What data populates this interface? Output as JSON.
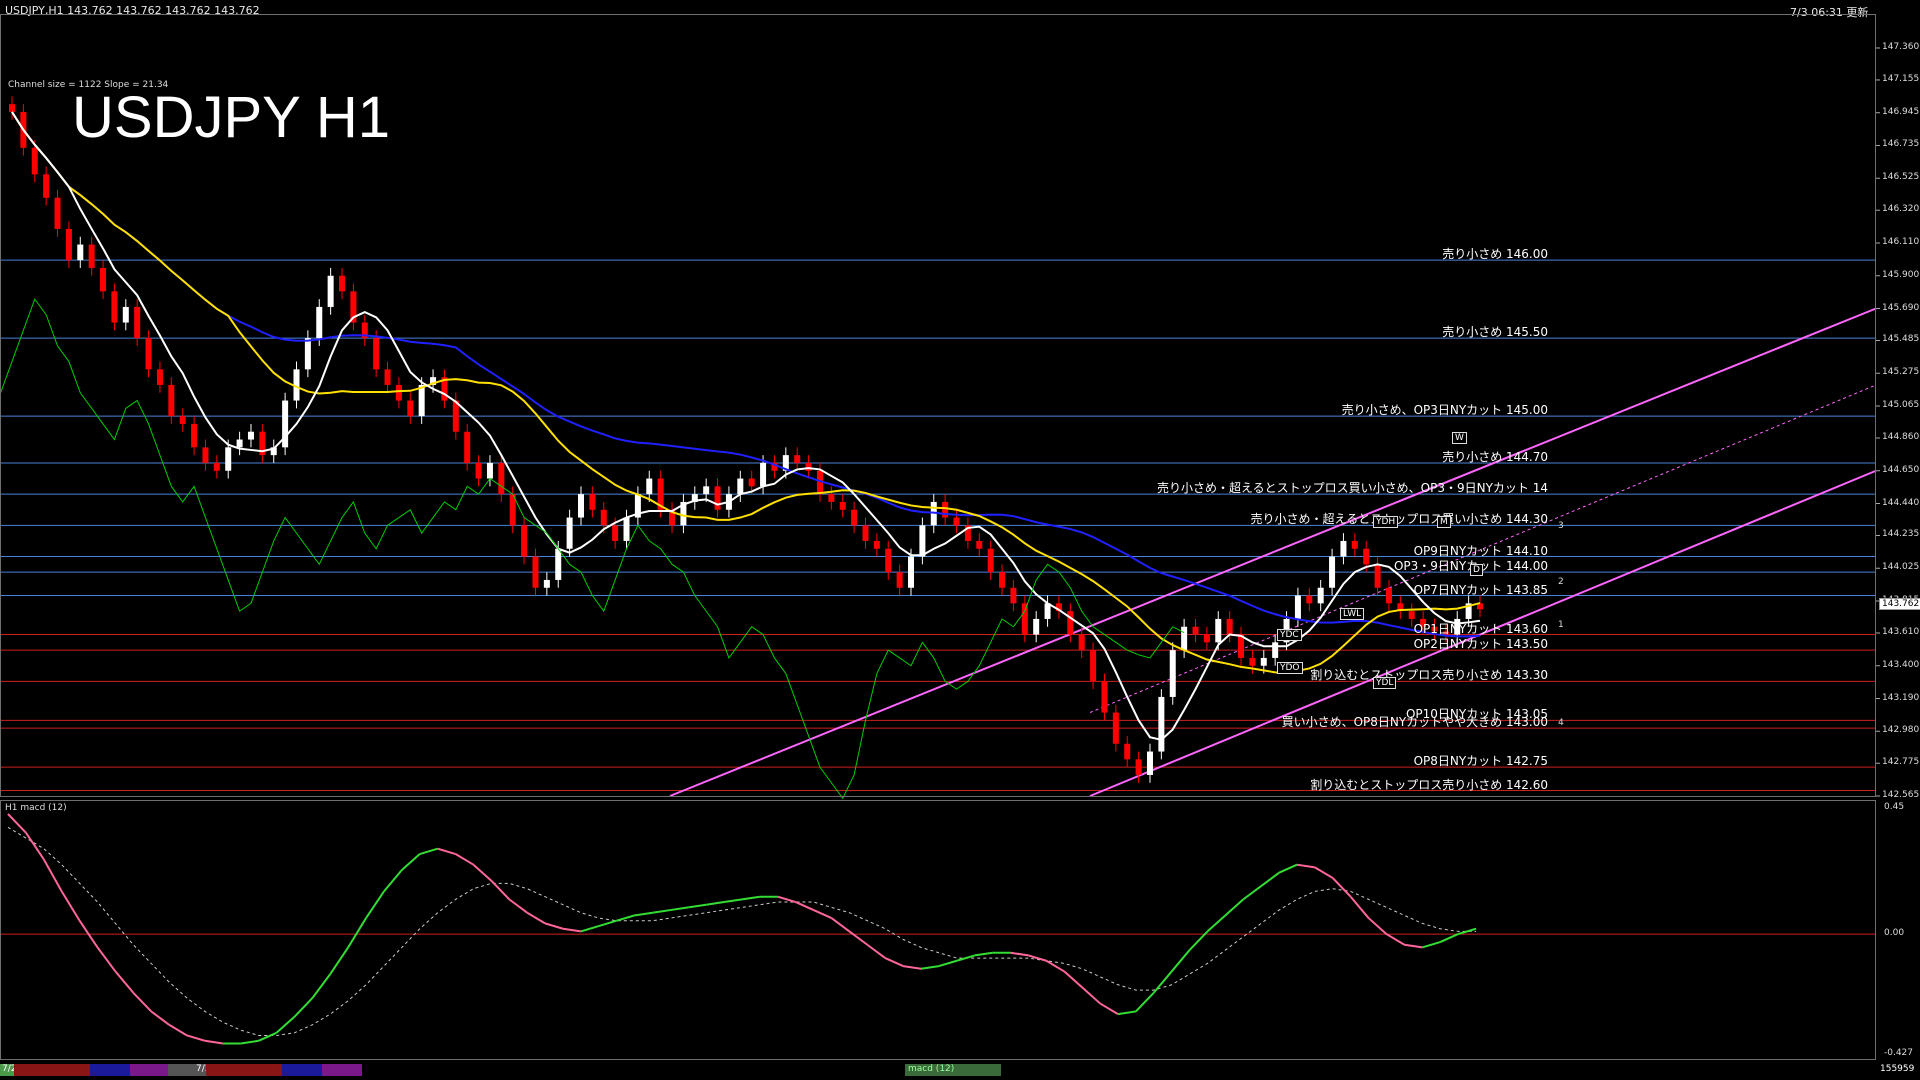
{
  "header": {
    "symbol_info": "USDJPY,H1  143.762 143.762 143.762 143.762",
    "datetime": "7/3 06:31 更新",
    "channel_info": "Channel size = 1122 Slope = 21.34",
    "big_title": "USDJPY H1"
  },
  "current_price": "143.762",
  "macd_label": "H1  macd (12)",
  "macd_ticks": [
    "0.45",
    "0.00",
    "-0.427"
  ],
  "bottom_right_value": "155959",
  "bottom_tab_label": "macd (12)",
  "colors": {
    "background": "#000000",
    "bull_candle": "#ffffff",
    "bear_candle": "#ff0000",
    "ma_short": "#ffffff",
    "ma_mid": "#ffe000",
    "ma_long": "#2020ff",
    "chikou": "#00cc00",
    "channel": "#ff66ff",
    "macd_main": "#ff6699",
    "macd_up": "#33dd33",
    "signal": "#cccccc",
    "level_blue": "#4a82d8",
    "level_red": "#cc2020"
  },
  "chart_data": {
    "type": "candlestick",
    "title": "USDJPY H1",
    "ylim": [
      142.565,
      147.565
    ],
    "y_ticks": [
      "147.360",
      "147.155",
      "146.945",
      "146.735",
      "146.525",
      "146.320",
      "146.110",
      "145.900",
      "145.690",
      "145.485",
      "145.275",
      "145.065",
      "144.860",
      "144.650",
      "144.440",
      "144.235",
      "144.025",
      "143.815",
      "143.610",
      "143.400",
      "143.190",
      "142.980",
      "142.775",
      "142.565"
    ],
    "date_tabs": [
      "7/2",
      "7/3"
    ],
    "close_prices": [
      146.95,
      146.72,
      146.55,
      146.4,
      146.2,
      146.0,
      146.1,
      145.95,
      145.8,
      145.6,
      145.7,
      145.5,
      145.3,
      145.2,
      145.0,
      144.95,
      144.8,
      144.7,
      144.65,
      144.8,
      144.85,
      144.9,
      144.75,
      144.8,
      145.1,
      145.3,
      145.5,
      145.7,
      145.9,
      145.8,
      145.6,
      145.5,
      145.3,
      145.2,
      145.1,
      145.0,
      145.2,
      145.25,
      145.1,
      144.9,
      144.7,
      144.6,
      144.7,
      144.5,
      144.3,
      144.1,
      143.9,
      143.95,
      144.15,
      144.35,
      144.5,
      144.4,
      144.3,
      144.2,
      144.35,
      144.5,
      144.6,
      144.4,
      144.3,
      144.45,
      144.5,
      144.55,
      144.4,
      144.5,
      144.6,
      144.55,
      144.7,
      144.65,
      144.75,
      144.7,
      144.65,
      144.5,
      144.45,
      144.4,
      144.3,
      144.2,
      144.15,
      144.0,
      143.9,
      144.1,
      144.3,
      144.45,
      144.35,
      144.3,
      144.2,
      144.15,
      144.0,
      143.9,
      143.8,
      143.6,
      143.7,
      143.8,
      143.75,
      143.6,
      143.5,
      143.3,
      143.1,
      142.9,
      142.8,
      142.7,
      142.85,
      143.2,
      143.5,
      143.65,
      143.6,
      143.55,
      143.7,
      143.6,
      143.45,
      143.4,
      143.45,
      143.55,
      143.7,
      143.85,
      143.8,
      143.9,
      144.1,
      144.2,
      144.15,
      144.05,
      143.9,
      143.8,
      143.75,
      143.7,
      143.65,
      143.62,
      143.6,
      143.7,
      143.8,
      143.762
    ],
    "price_levels": [
      {
        "price": 146.0,
        "label": "売り小さめ 146.00",
        "color": "#4a82d8"
      },
      {
        "price": 145.5,
        "label": "売り小さめ 145.50",
        "color": "#4a82d8"
      },
      {
        "price": 145.0,
        "label": "売り小さめ、OP3日NYカット 145.00",
        "color": "#4a82d8"
      },
      {
        "price": 144.7,
        "label": "売り小さめ 144.70",
        "color": "#4a82d8"
      },
      {
        "price": 144.5,
        "label": "売り小さめ・超えるとストップロス買い小さめ、OP3・9日NYカット 14",
        "color": "#4a82d8"
      },
      {
        "price": 144.3,
        "label": "売り小さめ・超えるとストップロス買い小さめ 144.30",
        "color": "#4a82d8"
      },
      {
        "price": 144.1,
        "label": "OP9日NYカット 144.10",
        "color": "#4a82d8"
      },
      {
        "price": 144.0,
        "label": "OP3・9日NYカット 144.00",
        "color": "#4a82d8"
      },
      {
        "price": 143.85,
        "label": "OP7日NYカット 143.85",
        "color": "#4a82d8"
      },
      {
        "price": 143.6,
        "label": "OP1日NYカット 143.60",
        "color": "#cc2020"
      },
      {
        "price": 143.5,
        "label": "OP2日NYカット 143.50",
        "color": "#cc2020"
      },
      {
        "price": 143.3,
        "label": "割り込むとストップロス売り小さめ 143.30",
        "color": "#cc2020"
      },
      {
        "price": 143.05,
        "label": "OP10日NYカット 143.05",
        "color": "#cc2020"
      },
      {
        "price": 143.0,
        "label": "買い小さめ、OP8日NYカットやや大きめ 143.00",
        "color": "#cc2020"
      },
      {
        "price": 142.75,
        "label": "OP8日NYカット 142.75",
        "color": "#cc2020"
      },
      {
        "price": 142.6,
        "label": "割り込むとストップロス売り小さめ 142.60",
        "color": "#cc2020"
      }
    ],
    "channel_numbers": [
      "1",
      "2",
      "3",
      "4"
    ],
    "marker_boxes": [
      "YDH",
      "YDC",
      "YDO",
      "YDL",
      "LWL",
      "D",
      "W",
      "M"
    ],
    "macd_main": [
      0.45,
      0.38,
      0.28,
      0.16,
      0.05,
      -0.05,
      -0.14,
      -0.22,
      -0.29,
      -0.34,
      -0.38,
      -0.4,
      -0.41,
      -0.41,
      -0.4,
      -0.37,
      -0.31,
      -0.24,
      -0.15,
      -0.05,
      0.06,
      0.16,
      0.24,
      0.3,
      0.32,
      0.3,
      0.26,
      0.2,
      0.13,
      0.08,
      0.04,
      0.02,
      0.01,
      0.03,
      0.05,
      0.07,
      0.08,
      0.09,
      0.1,
      0.11,
      0.12,
      0.13,
      0.14,
      0.14,
      0.12,
      0.09,
      0.06,
      0.01,
      -0.04,
      -0.09,
      -0.12,
      -0.13,
      -0.12,
      -0.1,
      -0.08,
      -0.07,
      -0.07,
      -0.08,
      -0.1,
      -0.14,
      -0.2,
      -0.26,
      -0.3,
      -0.29,
      -0.22,
      -0.14,
      -0.06,
      0.01,
      0.07,
      0.13,
      0.18,
      0.23,
      0.26,
      0.25,
      0.21,
      0.14,
      0.06,
      0.0,
      -0.04,
      -0.05,
      -0.03,
      0.0,
      0.02
    ],
    "macd_signal": [
      0.4,
      0.36,
      0.32,
      0.26,
      0.19,
      0.12,
      0.04,
      -0.04,
      -0.11,
      -0.18,
      -0.24,
      -0.29,
      -0.33,
      -0.36,
      -0.38,
      -0.38,
      -0.37,
      -0.34,
      -0.3,
      -0.25,
      -0.19,
      -0.12,
      -0.05,
      0.02,
      0.08,
      0.13,
      0.17,
      0.19,
      0.19,
      0.17,
      0.14,
      0.11,
      0.08,
      0.06,
      0.05,
      0.05,
      0.05,
      0.06,
      0.07,
      0.08,
      0.09,
      0.1,
      0.11,
      0.12,
      0.12,
      0.12,
      0.1,
      0.08,
      0.05,
      0.02,
      -0.02,
      -0.05,
      -0.07,
      -0.09,
      -0.09,
      -0.09,
      -0.09,
      -0.09,
      -0.1,
      -0.11,
      -0.13,
      -0.16,
      -0.19,
      -0.21,
      -0.21,
      -0.19,
      -0.15,
      -0.11,
      -0.06,
      -0.01,
      0.04,
      0.09,
      0.13,
      0.16,
      0.17,
      0.16,
      0.13,
      0.1,
      0.07,
      0.04,
      0.02,
      0.01,
      0.01
    ]
  }
}
